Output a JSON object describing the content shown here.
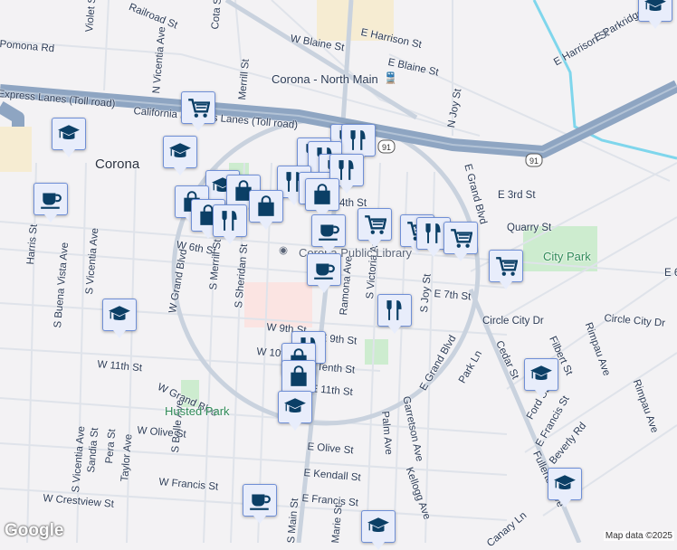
{
  "map": {
    "city_label": "Corona",
    "station_label": "Corona - North Main",
    "library_label": "Corona Public Library",
    "parks": [
      "City Park",
      "Husted Park"
    ],
    "highway_shields": [
      "91",
      "91"
    ],
    "street_labels": [
      "Railroad St",
      "Violet St",
      "Cota St",
      "Pomona Rd",
      "N Vicentia Ave",
      "Merrill St",
      "W Blaine St",
      "E Harrison St",
      "E Blaine St",
      "N Joy St",
      "E Harrison St",
      "E Parkridge",
      "Express Lanes (Toll road)",
      "California Express Lanes (Toll road)",
      "E Grand Blvd",
      "E 3rd St",
      "Quarry St",
      "4th St",
      "3rd St",
      "W 6th St",
      "E 6th St",
      "Harris St",
      "S Buena Vista Ave",
      "S Vicentia Ave",
      "W Grand Blvd",
      "S Merrill St",
      "S Sheridan St",
      "Ramona Ave",
      "S Victoria Ave",
      "S Joy St",
      "E 7th St",
      "Circle City Dr",
      "Circle City Dr",
      "Rimpau Ave",
      "W 9th St",
      "E 9th St",
      "W 10th St",
      "E Tenth St",
      "W 11th St",
      "E 11th St",
      "W Grand Blvd",
      "Cedar St",
      "Filbert St",
      "Park Ln",
      "E Grand Blvd",
      "Garretson Ave",
      "Palm Ave",
      "S Belle Ave",
      "W Olive St",
      "E Olive St",
      "E Kendall St",
      "W Francis St",
      "E Francis St",
      "S Main St",
      "W Crestview St",
      "Sandia St",
      "Pera St",
      "Taylor Ave",
      "S Vicentia Ave",
      "Kellogg Ave",
      "Ford St",
      "E Francis St",
      "Beverly Rd",
      "Fullerton Ave",
      "Canary Ln",
      "Marie St",
      "Rimpau Ave"
    ],
    "markers": [
      "shopping-cart",
      "school",
      "school",
      "coffee",
      "restaurant",
      "restaurant",
      "restaurant",
      "restaurant",
      "restaurant",
      "restaurant",
      "restaurant",
      "restaurant",
      "school",
      "shopping-bag",
      "shopping-bag",
      "shopping-bag",
      "shopping-bag",
      "restaurant",
      "shopping-bag",
      "coffee",
      "coffee",
      "shopping-cart",
      "shopping-cart",
      "restaurant",
      "shopping-cart",
      "shopping-cart",
      "school",
      "restaurant",
      "restaurant",
      "shopping-bag",
      "shopping-bag",
      "school",
      "school",
      "school",
      "coffee",
      "school",
      "school"
    ],
    "google_logo": "Google",
    "attribution": "Map data ©2025"
  },
  "colors": {
    "marker_icon": "#0b3f66",
    "marker_bg": "#e8edfb",
    "freeway": "#8ea5c2",
    "park": "#cdeccf"
  }
}
